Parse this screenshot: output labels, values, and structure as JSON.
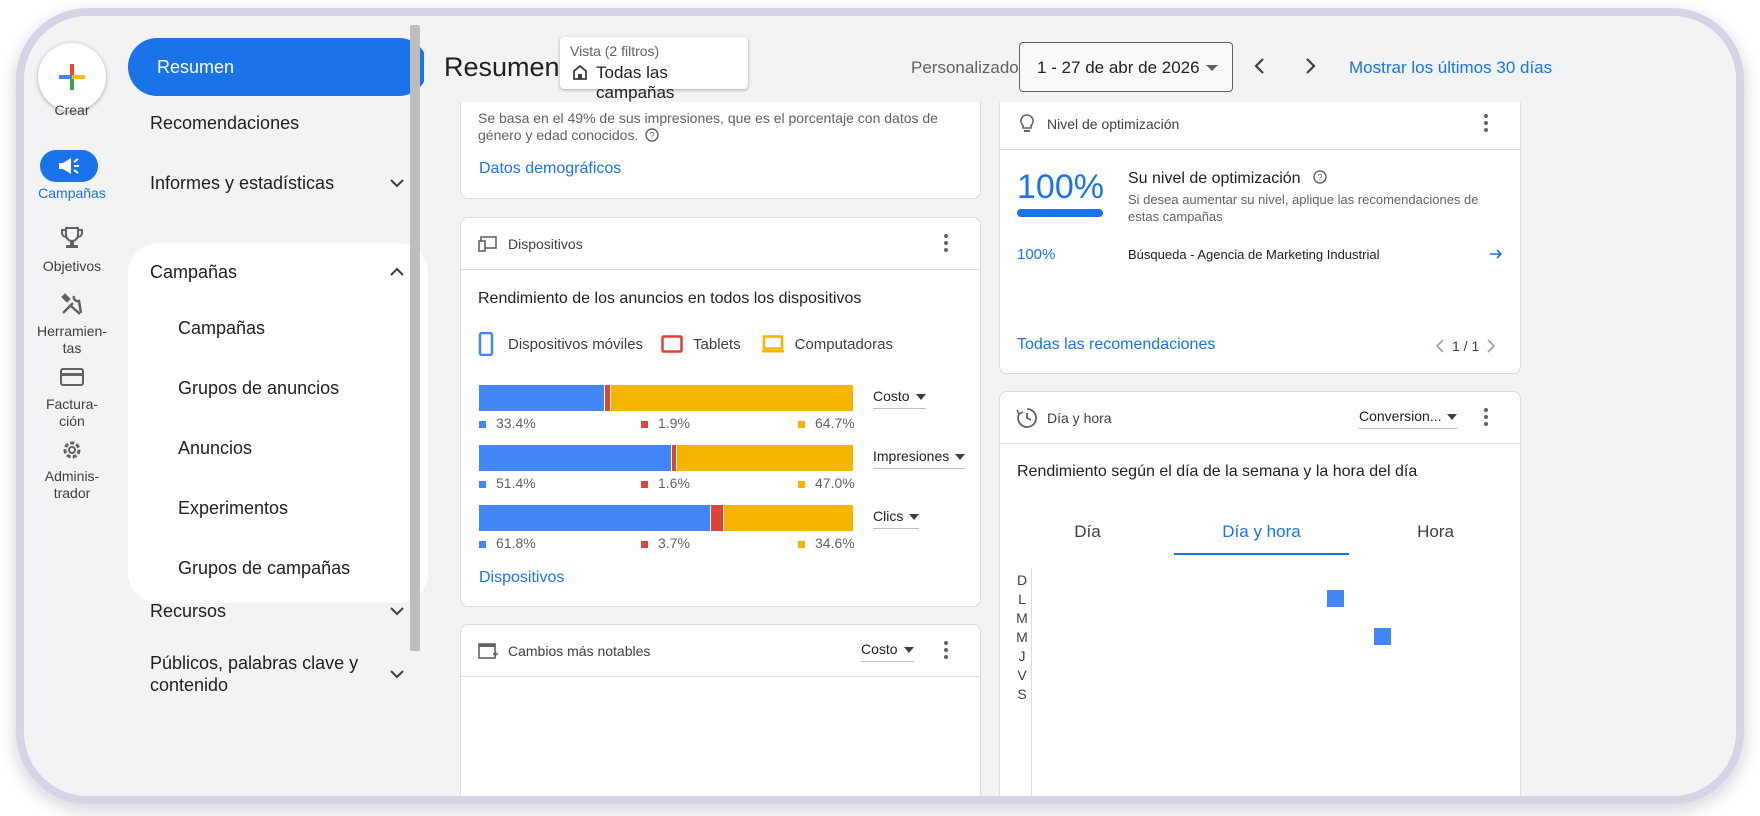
{
  "rail": {
    "create_label": "Crear",
    "items": [
      {
        "label": "Campañas",
        "icon": "megaphone-icon"
      },
      {
        "label": "Objetivos",
        "icon": "trophy-icon"
      },
      {
        "label": "Herramien-\ntas",
        "icon": "tools-icon"
      },
      {
        "label": "Factura-\nción",
        "icon": "credit-card-icon"
      },
      {
        "label": "Adminis-\ntrador",
        "icon": "gear-icon"
      }
    ]
  },
  "nav": {
    "resumen": "Resumen",
    "recomendaciones": "Recomendaciones",
    "informes": "Informes y estadísticas",
    "campanas_group": "Campañas",
    "sub": [
      "Campañas",
      "Grupos de anuncios",
      "Anuncios",
      "Experimentos",
      "Grupos de campañas"
    ],
    "recursos": "Recursos",
    "publicos": "Públicos, palabras clave y contenido"
  },
  "header": {
    "title": "Resumen",
    "view_top": "Vista (2 filtros)",
    "view_main": "Todas las campañas",
    "custom_label": "Personalizado",
    "date_range": "1 - 27 de abr de 2026",
    "last30": "Mostrar los últimos 30 días"
  },
  "demographics": {
    "text": "Se basa en el 49% de sus impresiones, que es el porcentaje con datos de género y edad conocidos.",
    "link": "Datos demográficos"
  },
  "devices": {
    "title": "Dispositivos",
    "subtitle": "Rendimiento de los anuncios en todos los dispositivos",
    "legend": [
      "Dispositivos móviles",
      "Tablets",
      "Computadoras"
    ],
    "colors": {
      "mobile": "#4285f4",
      "tablet": "#db4437",
      "desktop": "#f4b400"
    },
    "rows": [
      {
        "metric": "Costo",
        "mobile": "33.4%",
        "tablet": "1.9%",
        "desktop": "64.7%",
        "values": [
          33.4,
          1.9,
          64.7
        ]
      },
      {
        "metric": "Impresiones",
        "mobile": "51.4%",
        "tablet": "1.6%",
        "desktop": "47.0%",
        "values": [
          51.4,
          1.6,
          47.0
        ]
      },
      {
        "metric": "Clics",
        "mobile": "61.8%",
        "tablet": "3.7%",
        "desktop": "34.6%",
        "values": [
          61.8,
          3.7,
          34.6
        ]
      }
    ],
    "link": "Dispositivos"
  },
  "changes": {
    "title": "Cambios más notables",
    "metric": "Costo"
  },
  "optimization": {
    "title": "Nivel de optimización",
    "score": "100%",
    "heading": "Su nivel de optimización",
    "desc": "Si desea aumentar su nivel, aplique las recomendaciones de estas campañas",
    "row_score": "100%",
    "row_campaign": "Búsqueda - Agencia de Marketing Industrial",
    "link": "Todas las recomendaciones",
    "pager": "1 / 1"
  },
  "dayhour": {
    "title": "Día y hora",
    "metric": "Conversion...",
    "subtitle": "Rendimiento según el día de la semana y la hora del día",
    "tabs": [
      "Día",
      "Día y hora",
      "Hora"
    ],
    "days": [
      "D",
      "L",
      "M",
      "M",
      "J",
      "V",
      "S"
    ],
    "points": [
      {
        "day": 1,
        "hour": 0.2
      },
      {
        "day": 3,
        "hour": 0.3
      }
    ]
  }
}
